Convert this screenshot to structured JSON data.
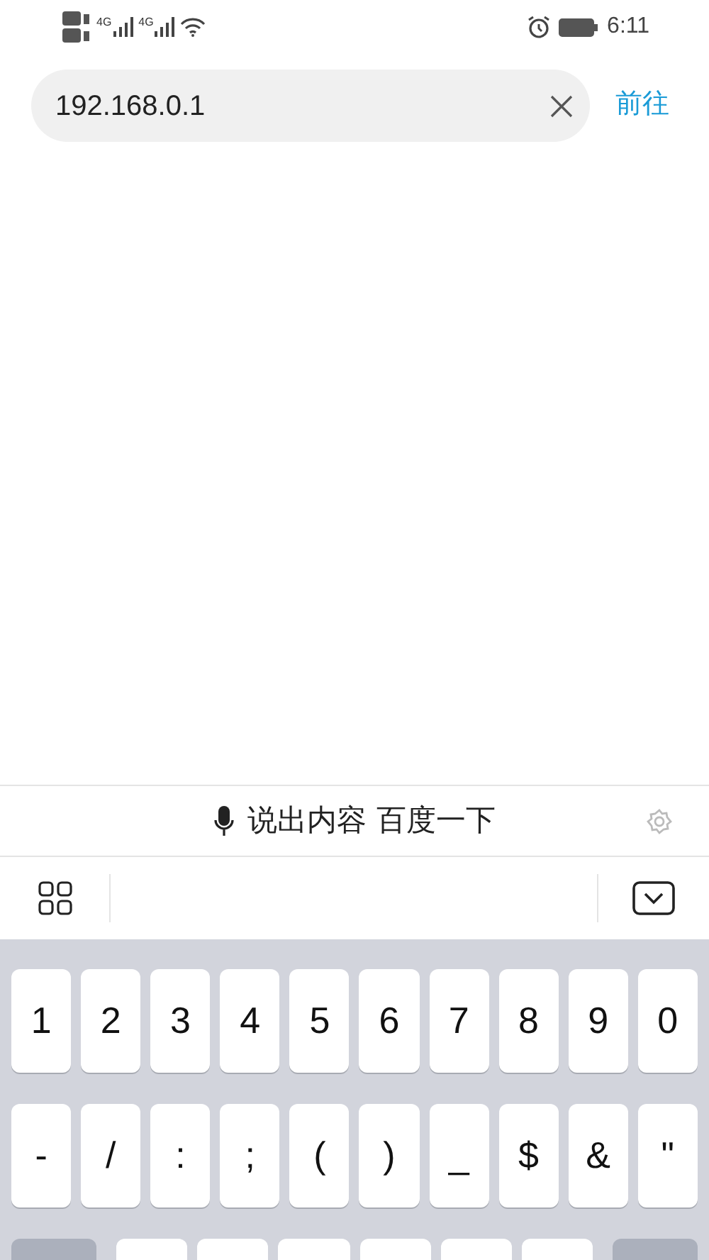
{
  "status_bar": {
    "network_types": [
      "4G",
      "4G"
    ],
    "time": "6:11"
  },
  "address_bar": {
    "value": "192.168.0.1",
    "go_button": "前往"
  },
  "voice_bar": {
    "label": "说出内容 百度一下"
  },
  "keyboard": {
    "rows": [
      [
        "1",
        "2",
        "3",
        "4",
        "5",
        "6",
        "7",
        "8",
        "9",
        "0"
      ],
      [
        "-",
        "/",
        ":",
        ";",
        "(",
        ")",
        "_",
        "$",
        "&",
        "\""
      ]
    ]
  }
}
